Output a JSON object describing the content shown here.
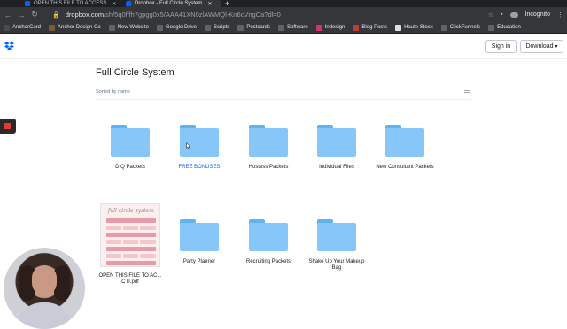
{
  "browser": {
    "tabs": [
      {
        "title": "OPEN THIS FILE TO ACCESS",
        "active": false
      },
      {
        "title": "Dropbox - Full Circle System",
        "active": true
      }
    ],
    "url_main": "dropbox.com",
    "url_rest": "/sh/5q0fffh7gpgg0x5/AAA41XN0zlAWMQl-Kn6cVngCa?dl=0",
    "incognito_label": "Incognito"
  },
  "bookmarks": [
    {
      "label": "AnchorCard",
      "color": "#4a4a4a"
    },
    {
      "label": "Anchor Design Co",
      "color": "#7a5a3a"
    },
    {
      "label": "New Website",
      "color": "#5f6368"
    },
    {
      "label": "Google Drive",
      "color": "#5f6368"
    },
    {
      "label": "Scripts",
      "color": "#5f6368"
    },
    {
      "label": "Postcards",
      "color": "#5f6368"
    },
    {
      "label": "Software",
      "color": "#5f6368"
    },
    {
      "label": "Indesign",
      "color": "#d6336c"
    },
    {
      "label": "Blog Posts",
      "color": "#c23a3a"
    },
    {
      "label": "Haute Stock",
      "color": "#e0e0e0"
    },
    {
      "label": "ClickFunnels",
      "color": "#5f6368"
    },
    {
      "label": "Education",
      "color": "#5f6368"
    }
  ],
  "header": {
    "signin_label": "Sign in",
    "download_label": "Download"
  },
  "folder_view": {
    "title": "Full Circle System",
    "sort_label": "Sorted by name",
    "items": [
      {
        "name": "DIQ Packets",
        "type": "folder"
      },
      {
        "name": "FREE BONUSES",
        "type": "folder",
        "hovered": true
      },
      {
        "name": "Hostess Packets",
        "type": "folder"
      },
      {
        "name": "Individual Files",
        "type": "folder"
      },
      {
        "name": "New Consultant Packets",
        "type": "folder"
      },
      {
        "name_line1": "OPEN THIS FILE TO AC...",
        "name_line2": "CTI.pdf",
        "type": "pdf",
        "thumb_script": "full circle system"
      },
      {
        "name": "Party Planner",
        "type": "folder"
      },
      {
        "name": "Recruiting Packets",
        "type": "folder"
      },
      {
        "name_line1": "Shake Up Your Makeup",
        "name_line2": "Bag",
        "type": "folder"
      }
    ]
  },
  "colors": {
    "accent": "#0061fe",
    "folder": "#86c6f8",
    "record": "#e53935"
  }
}
